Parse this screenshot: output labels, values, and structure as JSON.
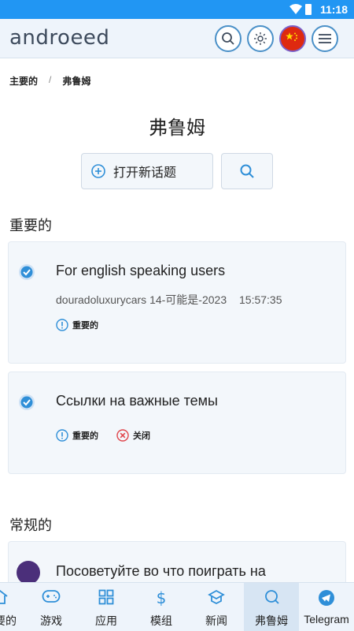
{
  "status": {
    "time": "11:18"
  },
  "header": {
    "logo": "androeed"
  },
  "breadcrumb": {
    "home": "主要的",
    "sep": "/",
    "current": "弗鲁姆"
  },
  "page_title": "弗鲁姆",
  "actions": {
    "new_topic": "打开新话题"
  },
  "important": {
    "title": "重要的",
    "cards": [
      {
        "title": "For english speaking users",
        "author": "douradoluxurycars",
        "date": "14-可能是-2023",
        "time": "15:57:35",
        "tags": [
          "重要的"
        ]
      },
      {
        "title": "Ссылки на важные темы",
        "tags": [
          "重要的",
          "关闭"
        ]
      }
    ]
  },
  "regular": {
    "title": "常规的",
    "cards": [
      {
        "title": "Посоветуйте во что поиграть на"
      }
    ]
  },
  "nav": [
    {
      "label": "主要的",
      "icon": "home-icon"
    },
    {
      "label": "游戏",
      "icon": "gamepad-icon"
    },
    {
      "label": "应用",
      "icon": "grid-icon"
    },
    {
      "label": "模组",
      "icon": "dollar-icon"
    },
    {
      "label": "新闻",
      "icon": "news-icon"
    },
    {
      "label": "弗鲁姆",
      "icon": "chat-icon"
    },
    {
      "label": "Telegram",
      "icon": "telegram-icon"
    }
  ],
  "colors": {
    "accent": "#2196f3",
    "header_bg": "#eef4fb",
    "card_bg": "#f3f7fb",
    "icon_blue": "#2f8fd8",
    "close_red": "#e0454b"
  }
}
